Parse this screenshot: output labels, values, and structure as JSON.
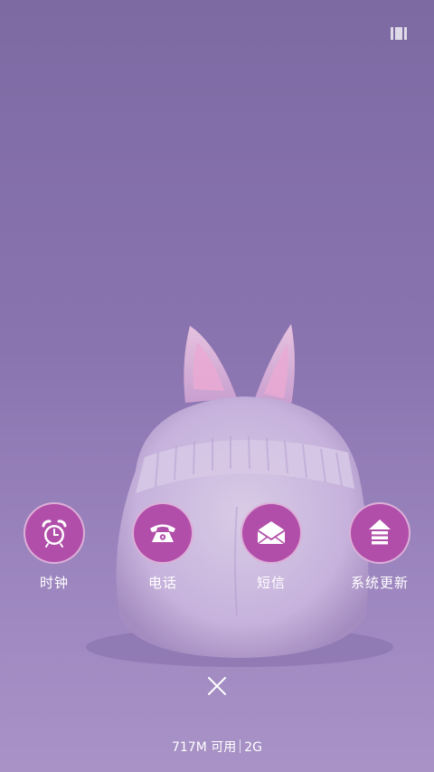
{
  "apps": [
    {
      "label": "时钟",
      "icon": "alarm-clock-icon"
    },
    {
      "label": "电话",
      "icon": "telephone-icon"
    },
    {
      "label": "短信",
      "icon": "envelope-icon"
    },
    {
      "label": "系统更新",
      "icon": "update-arrow-icon"
    }
  ],
  "close_icon": "close-icon",
  "memory": {
    "available": "717M 可用",
    "total": "2G"
  },
  "colors": {
    "accent": "#b14ea9",
    "background": "#8a74b0"
  }
}
